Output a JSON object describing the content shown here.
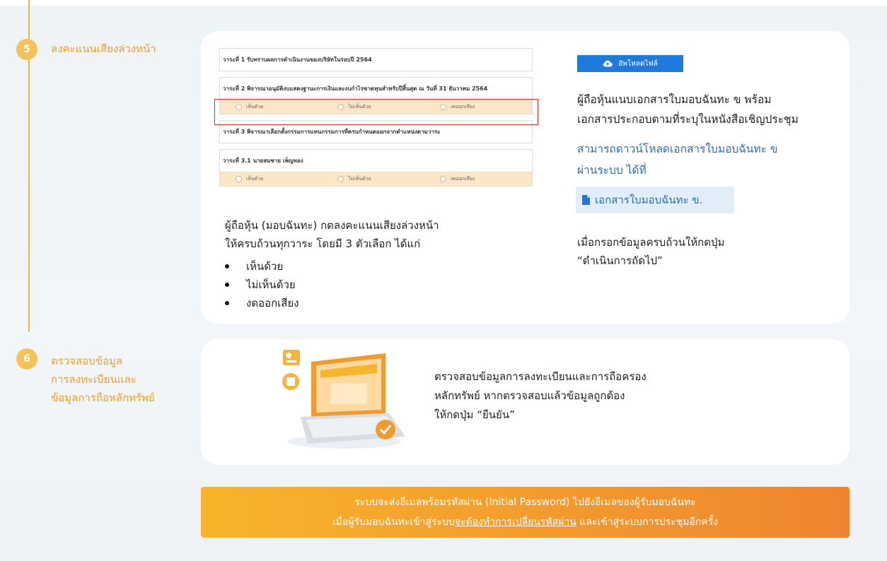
{
  "step5": {
    "number": "5",
    "title": "ลงคะแนนเสียงล่วงหน้า",
    "agenda": [
      {
        "title": "วาระที่ 1 รับทราบผลการดำเนินงานของบริษัทในรอบปี 2564",
        "has_vote": false
      },
      {
        "title": "วาระที่ 2 พิจารณาอนุมัติงบแสดงฐานะการเงินและงบกำไรขาดทุนสำหรับปีสิ้นสุด ณ วันที่ 31 ธันวาคม 2564",
        "has_vote": true
      },
      {
        "title": "วาระที่ 3 พิจารณาเลือกตั้งกรรมการแทนกรรมการที่ครบกำหนดออกจากตำแหน่งตามวาระ",
        "has_vote": false
      },
      {
        "title": "วาระที่ 3.1 นายสมชาย เพ็ญทอง",
        "has_vote": true
      }
    ],
    "vote_options": [
      "เห็นด้วย",
      "ไม่เห็นด้วย",
      "งดออกเสียง"
    ],
    "left_desc_line1": "ผู้ถือหุ้น (มอบฉันทะ) กดลงคะแนนเสียงล่วงหน้า",
    "left_desc_line2": "ให้ครบถ้วนทุกวาระ โดยมี 3 ตัวเลือก ได้แก่",
    "bullets": [
      "เห็นด้วย",
      "ไม่เห็นด้วย",
      "งดออกเสียง"
    ],
    "upload_label": "อัพโหลดไฟล์",
    "right_desc_line1": "ผู้ถือหุ้นแนบเอกสารใบมอบฉันทะ ข พร้อม",
    "right_desc_line2": "เอกสารประกอบตามที่ระบุในหนังสือเชิญประชุม",
    "download_line1": "สามารถดาวน์โหลดเอกสารใบมอบฉันทะ ข",
    "download_line2": "ผ่านระบบ ได้ที่",
    "doc_link_label": "เอกสารใบมอบฉันทะ ข.",
    "next_line1": "เมื่อกรอกข้อมูลครบถ้วนให้กดปุ่ม",
    "next_line2": "“ดำเนินการถัดไป”"
  },
  "step6": {
    "number": "6",
    "title_line1": "ตรวจสอบข้อมูล",
    "title_line2": "การลงทะเบียนและ",
    "title_line3": "ข้อมูลการถือหลักทรัพย์",
    "desc_line1": "ตรวจสอบข้อมูลการลงทะเบียนและการถือครอง",
    "desc_line2": "หลักทรัพย์ หากตรวจสอบแล้วข้อมูลถูกต้อง",
    "desc_line3": "ให้กดปุ่ม “ยืนยัน”"
  },
  "banner": {
    "line1": "ระบบจะส่งอีเมลพร้อมรหัสผ่าน (Initial Password) ไปยังอีเมลของผู้รับมอบฉันทะ",
    "line2_prefix": "เมื่อผู้รับมอบฉันทะเข้าสู่ระบบ",
    "line2_emph": "จะต้องทำการเปลี่ยนรหัสผ่าน",
    "line2_suffix": " และเข้าสู่ระบบการประชุมอีกครั้ง"
  },
  "colors": {
    "accent_orange": "#f0a028",
    "badge": "#f6c35a",
    "upload_blue": "#1f7ae0",
    "link_blue": "#2d6fb0",
    "highlight_red": "#e02a2a"
  }
}
